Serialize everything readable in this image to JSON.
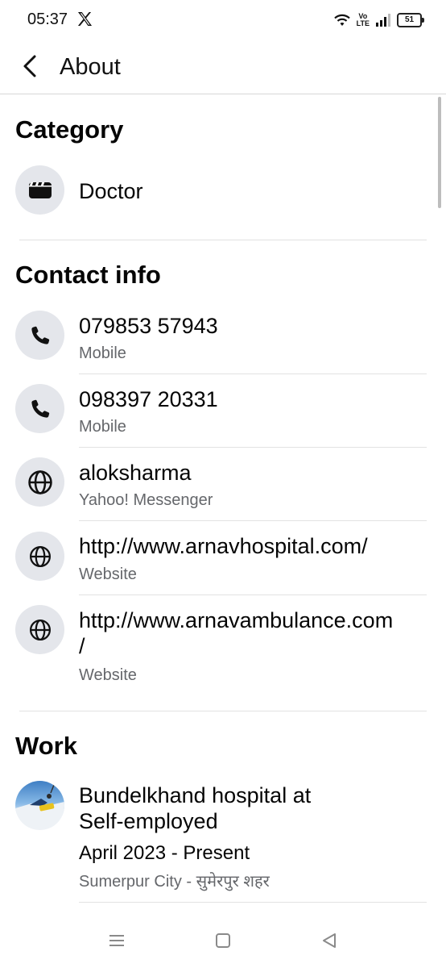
{
  "status_bar": {
    "time": "05:37",
    "volte_top": "Vo",
    "volte_bottom": "LTE",
    "battery": "51"
  },
  "header": {
    "title": "About"
  },
  "category": {
    "title": "Category",
    "value": "Doctor"
  },
  "contact": {
    "title": "Contact info",
    "items": [
      {
        "primary": "079853 57943",
        "secondary": "Mobile",
        "icon": "phone-icon"
      },
      {
        "primary": "098397 20331",
        "secondary": "Mobile",
        "icon": "phone-icon"
      },
      {
        "primary": "aloksharma",
        "secondary": "Yahoo! Messenger",
        "icon": "globe-icon"
      },
      {
        "primary": "http://www.arnavhospital.com/",
        "secondary": "Website",
        "icon": "globe-icon"
      },
      {
        "primary_line1": "http://www.arnavambulance.com",
        "primary_line2": "/",
        "secondary": "Website",
        "icon": "globe-icon"
      }
    ]
  },
  "work": {
    "title": "Work",
    "items": [
      {
        "line1": "Bundelkhand hospital at",
        "line2": "Self-employed",
        "dates": "April 2023 - Present",
        "location": "Sumerpur City - सुमेरपुर शहर"
      }
    ]
  },
  "colors": {
    "icon_bg": "#e4e6eb",
    "secondary_text": "#65676b",
    "divider": "#e2e2e2"
  }
}
